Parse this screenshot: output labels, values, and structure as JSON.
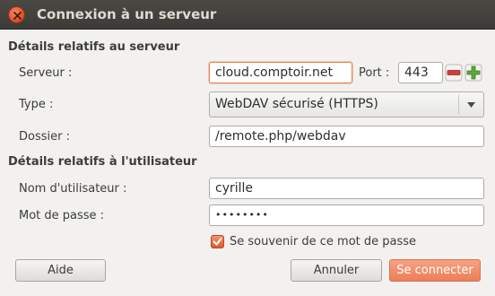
{
  "window": {
    "title": "Connexion à un serveur"
  },
  "server_section": {
    "heading": "Détails relatifs au serveur",
    "server_label": "Serveur :",
    "server_value": "cloud.comptoir.net",
    "port_label": "Port :",
    "port_value": "443",
    "type_label": "Type :",
    "type_value": "WebDAV sécurisé (HTTPS)",
    "folder_label": "Dossier :",
    "folder_value": "/remote.php/webdav"
  },
  "user_section": {
    "heading": "Détails relatifs à l'utilisateur",
    "username_label": "Nom d'utilisateur :",
    "username_value": "cyrille",
    "password_label": "Mot de passe :",
    "password_value": "••••••••",
    "remember_label": "Se souvenir de ce mot de passe",
    "remember_checked": true
  },
  "buttons": {
    "help": "Aide",
    "cancel": "Annuler",
    "connect": "Se connecter"
  },
  "colors": {
    "accent": "#e9804d",
    "titlebar": "#3c3b37",
    "spin_minus": "#d23c3c",
    "spin_plus": "#5da83a"
  }
}
